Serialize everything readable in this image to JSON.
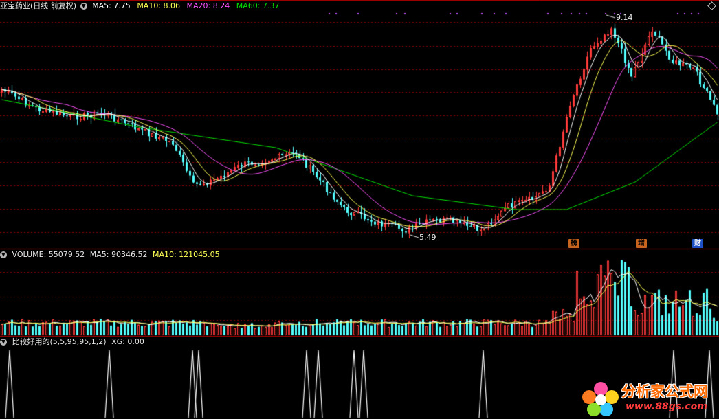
{
  "colors": {
    "up": "#ff3b3b",
    "down": "#54ffff",
    "ma5": "#ffffff",
    "ma10": "#ffff54",
    "ma20": "#ff54ff",
    "ma60": "#00e600",
    "grid": "#8b0000",
    "background": "#000000"
  },
  "price_panel": {
    "stock_name": "亚宝药业(日线 前复权)",
    "ma5": "MA5: 7.75",
    "ma10": "MA10: 8.06",
    "ma20": "MA20: 8.24",
    "ma60": "MA60: 7.37",
    "high_marker": "9.14",
    "low_marker": "5.49",
    "event_markers": [
      "榜",
      "增",
      "财"
    ]
  },
  "volume_panel": {
    "title": "VOLUME: 55079.52",
    "ma5": "MA5: 90346.52",
    "ma10": "MA10: 121045.05"
  },
  "indicator_panel": {
    "title": "比较好用的(5,5,95,95,1,2)",
    "value": "XG: 0.00"
  },
  "watermark": {
    "text": "分析家公式网",
    "url": "www.88gs.com"
  }
}
